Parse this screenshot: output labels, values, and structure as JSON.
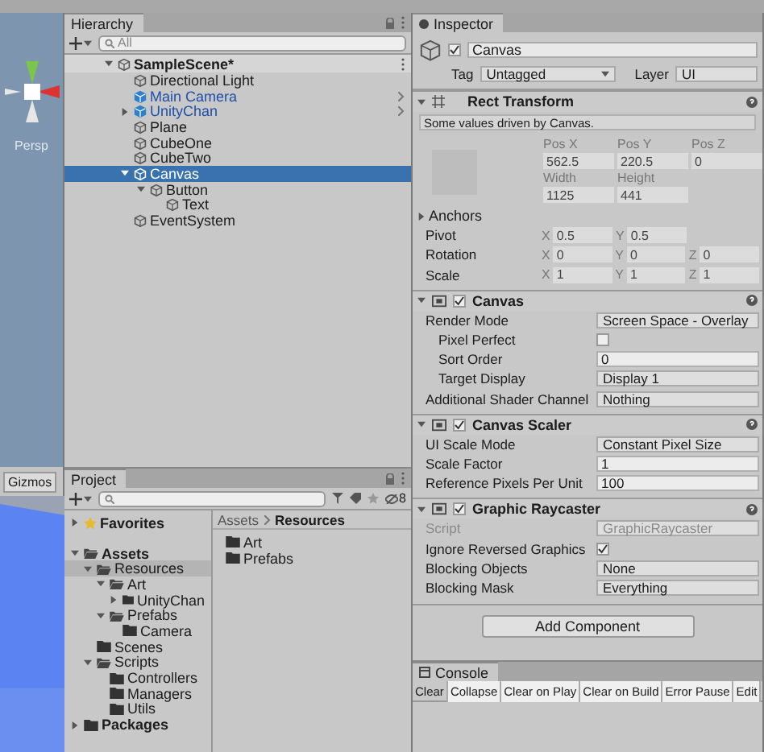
{
  "scene_view": {
    "camera_label": "Persp",
    "gizmos": "Gizmos"
  },
  "hierarchy": {
    "title": "Hierarchy",
    "search_placeholder": "All",
    "scene": {
      "label": "SampleScene*",
      "expanded": true,
      "children": [
        {
          "label": "Directional Light",
          "kind": "object",
          "selected": false
        },
        {
          "label": "Main Camera",
          "kind": "prefab",
          "selected": false
        },
        {
          "label": "UnityChan",
          "kind": "prefab",
          "expanded": false,
          "selected": false
        },
        {
          "label": "Plane",
          "kind": "object",
          "selected": false
        },
        {
          "label": "CubeOne",
          "kind": "object",
          "selected": false
        },
        {
          "label": "CubeTwo",
          "kind": "object",
          "selected": false
        },
        {
          "label": "Canvas",
          "kind": "object",
          "expanded": true,
          "selected": true,
          "children": [
            {
              "label": "Button",
              "kind": "object",
              "expanded": true,
              "selected": false,
              "children": [
                {
                  "label": "Text",
                  "kind": "object",
                  "selected": false
                }
              ]
            }
          ]
        },
        {
          "label": "EventSystem",
          "kind": "object",
          "selected": false
        }
      ]
    }
  },
  "project": {
    "title": "Project",
    "hidden_count": "8",
    "tree": [
      {
        "label": "Favorites",
        "kind": "favorites",
        "expanded": false,
        "selected": false
      },
      {
        "label": "Assets",
        "kind": "root",
        "expanded": true,
        "selected": false,
        "children": [
          {
            "label": "Resources",
            "kind": "folder",
            "expanded": true,
            "selected": true,
            "children": [
              {
                "label": "Art",
                "kind": "folder",
                "expanded": true,
                "selected": false,
                "children": [
                  {
                    "label": "UnityChan",
                    "kind": "folder",
                    "expanded": false,
                    "selected": false
                  }
                ]
              },
              {
                "label": "Prefabs",
                "kind": "folder",
                "expanded": true,
                "selected": false,
                "children": [
                  {
                    "label": "Camera",
                    "kind": "folder",
                    "selected": false
                  }
                ]
              }
            ]
          },
          {
            "label": "Scenes",
            "kind": "folder",
            "selected": false
          },
          {
            "label": "Scripts",
            "kind": "folder",
            "expanded": true,
            "selected": false,
            "children": [
              {
                "label": "Controllers",
                "kind": "folder",
                "selected": false
              },
              {
                "label": "Managers",
                "kind": "folder",
                "selected": false
              },
              {
                "label": "Utils",
                "kind": "folder",
                "selected": false
              }
            ]
          }
        ]
      },
      {
        "label": "Packages",
        "kind": "root",
        "expanded": false,
        "selected": false
      }
    ],
    "breadcrumb": [
      "Assets",
      "Resources"
    ],
    "files": [
      "Art",
      "Prefabs"
    ]
  },
  "inspector": {
    "title": "Inspector",
    "object": {
      "name": "Canvas",
      "active": true,
      "tag_label": "Tag",
      "tag": "Untagged",
      "layer_label": "Layer",
      "layer": "UI"
    },
    "rect_transform": {
      "title": "Rect Transform",
      "expanded": true,
      "note": "Some values driven by Canvas.",
      "position": [
        {
          "label": "Pos X",
          "value": "562.5"
        },
        {
          "label": "Pos Y",
          "value": "220.5"
        },
        {
          "label": "Pos Z",
          "value": "0"
        }
      ],
      "size": [
        {
          "label": "Width",
          "value": "1125"
        },
        {
          "label": "Height",
          "value": "441"
        }
      ],
      "anchors": {
        "label": "Anchors",
        "expanded": false
      },
      "vectors": [
        {
          "label": "Pivot",
          "axes": [
            {
              "axis": "X",
              "value": "0.5"
            },
            {
              "axis": "Y",
              "value": "0.5"
            }
          ]
        },
        {
          "label": "Rotation",
          "axes": [
            {
              "axis": "X",
              "value": "0"
            },
            {
              "axis": "Y",
              "value": "0"
            },
            {
              "axis": "Z",
              "value": "0"
            }
          ]
        },
        {
          "label": "Scale",
          "axes": [
            {
              "axis": "X",
              "value": "1"
            },
            {
              "axis": "Y",
              "value": "1"
            },
            {
              "axis": "Z",
              "value": "1"
            }
          ]
        }
      ]
    },
    "components": [
      {
        "title": "Canvas",
        "expanded": true,
        "enabled": true,
        "rows": [
          {
            "label": "Render Mode",
            "kind": "dropdown",
            "value": "Screen Space - Overlay",
            "children": [
              {
                "label": "Pixel Perfect",
                "kind": "checkbox",
                "checked": false
              },
              {
                "label": "Sort Order",
                "kind": "field",
                "value": "0"
              },
              {
                "label": "Target Display",
                "kind": "dropdown",
                "value": "Display 1"
              }
            ]
          },
          {
            "label": "Additional Shader Channel",
            "kind": "dropdown",
            "value": "Nothing"
          }
        ]
      },
      {
        "title": "Canvas Scaler",
        "expanded": true,
        "enabled": true,
        "rows": [
          {
            "label": "UI Scale Mode",
            "kind": "dropdown",
            "value": "Constant Pixel Size"
          },
          {
            "label": "Scale Factor",
            "kind": "field",
            "value": "1"
          },
          {
            "label": "Reference Pixels Per Unit",
            "kind": "field",
            "value": "100"
          }
        ]
      },
      {
        "title": "Graphic Raycaster",
        "expanded": true,
        "enabled": true,
        "rows": [
          {
            "label": "Script",
            "kind": "script",
            "value": "GraphicRaycaster",
            "disabled": true
          },
          {
            "label": "Ignore Reversed Graphics",
            "kind": "checkbox",
            "checked": true
          },
          {
            "label": "Blocking Objects",
            "kind": "dropdown",
            "value": "None"
          },
          {
            "label": "Blocking Mask",
            "kind": "dropdown",
            "value": "Everything"
          }
        ]
      }
    ],
    "add_component": "Add Component"
  },
  "console": {
    "title": "Console",
    "buttons": [
      "Clear",
      "Collapse",
      "Clear on Play",
      "Clear on Build",
      "Error Pause",
      "Edit"
    ]
  }
}
